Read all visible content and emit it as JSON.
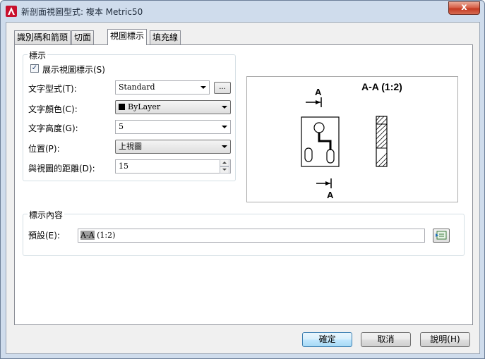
{
  "window": {
    "title": "新剖面視圖型式: 複本 Metric50",
    "close_glyph": "x"
  },
  "tabs": [
    {
      "label": "識別碼和箭頭",
      "active": false
    },
    {
      "label": "切面",
      "active": false
    },
    {
      "label": "視圖標示",
      "active": true
    },
    {
      "label": "填充線",
      "active": false
    }
  ],
  "label_group": {
    "title": "標示",
    "show_label": {
      "label": "展示視圖標示(S)",
      "checked": true,
      "check_glyph": "✓"
    },
    "text_style": {
      "label": "文字型式(T):",
      "value": "Standard",
      "browse": "..."
    },
    "text_color": {
      "label": "文字顏色(C):",
      "value": "ByLayer"
    },
    "text_height": {
      "label": "文字高度(G):",
      "value": "5"
    },
    "position": {
      "label": "位置(P):",
      "value": "上視圖"
    },
    "distance": {
      "label": "與視圖的距離(D):",
      "value": "15"
    }
  },
  "preview": {
    "view_label": "A-A (1:2)",
    "cut_top_letter": "A",
    "cut_bottom_letter": "A"
  },
  "content_group": {
    "title": "標示內容",
    "default_label": "預設(E):",
    "default_value_highlight": "A-A",
    "default_value_rest": " (1:2)",
    "field_button_icon": "insert-field-icon"
  },
  "buttons": {
    "ok": "確定",
    "cancel": "取消",
    "help": "說明(H)"
  }
}
